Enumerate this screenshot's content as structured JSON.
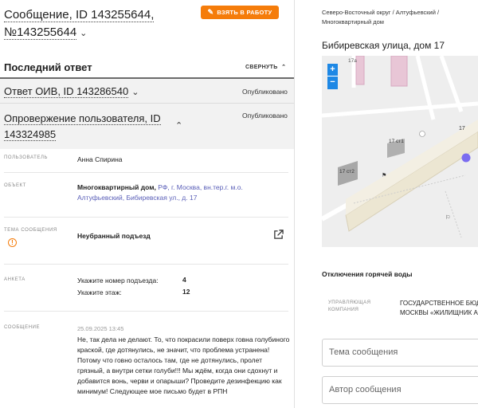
{
  "message": {
    "title_line1": "Сообщение, ID 143255644,",
    "title_line2": "№143255644",
    "take_button": "ВЗЯТЬ В РАБОТУ"
  },
  "last_reply": {
    "heading": "Последний ответ",
    "collapse_label": "СВЕРНУТЬ"
  },
  "reply_oiv": {
    "title": "Ответ ОИВ, ID 143286540",
    "status": "Опубликовано"
  },
  "refutation": {
    "title": "Опровержение пользователя, ID 143324985",
    "status": "Опубликовано"
  },
  "details": {
    "user_label": "ПОЛЬЗОВАТЕЛЬ",
    "user_value": "Анна Спирина",
    "object_label": "ОБЪЕКТ",
    "object_type": "Многоквартирный дом,",
    "object_address": "РФ, г. Москва, вн.тер.г. м.о. Алтуфьевский, Бибиревская ул., д. 17",
    "topic_label": "ТЕМА СООБЩЕНИЯ",
    "topic_value": "Неубранный подъезд",
    "form_label": "АНКЕТА",
    "q1_label": "Укажите номер подъезда:",
    "q1_value": "4",
    "q2_label": "Укажите этаж:",
    "q2_value": "12",
    "message_label": "СООБЩЕНИЕ",
    "message_date": "25.09.2025 13:45",
    "message_text": "Не, так дела не делают. То, что покрасили поверх говна голубиного краской, где дотянулись, не значит, что проблема устранена! Потому что говно осталось там, где не дотянулись, пролет грязный, а внутри сетки голуби!!! Мы ждём, когда они сдохнут и добавится вонь, черви и опарыши? Проведите дезинфекцию как минимум! Следующее мое письмо будет в РПН"
  },
  "right": {
    "breadcrumb": "Северо-Восточный округ / Алтуфьевский / Многоквартирный дом",
    "address": "Бибиревская улица, дом 17",
    "map": {
      "label_17a": "17а",
      "label_17": "17",
      "label_17st1": "17 ст1",
      "label_17st2": "17 ст2",
      "zoom_in": "+",
      "zoom_out": "−"
    },
    "outage_title": "Отключения горячей воды",
    "mc_label": "УПРАВЛЯЮЩАЯ КОМПАНИЯ",
    "mc_value_line1": "ГОСУДАРСТВЕННОЕ БЮД",
    "mc_value_line2": "МОСКВЫ «ЖИЛИЩНИК А",
    "subject_placeholder": "Тема сообщения",
    "author_placeholder": "Автор сообщения"
  },
  "icons": {
    "pen": "pencil-icon",
    "warning": "warning-icon",
    "external": "external-link-icon"
  },
  "colors": {
    "accent": "#f57c0a",
    "link": "#5a5fb8",
    "map_marker": "#7b6cf0",
    "zoom": "#1e88e5"
  }
}
